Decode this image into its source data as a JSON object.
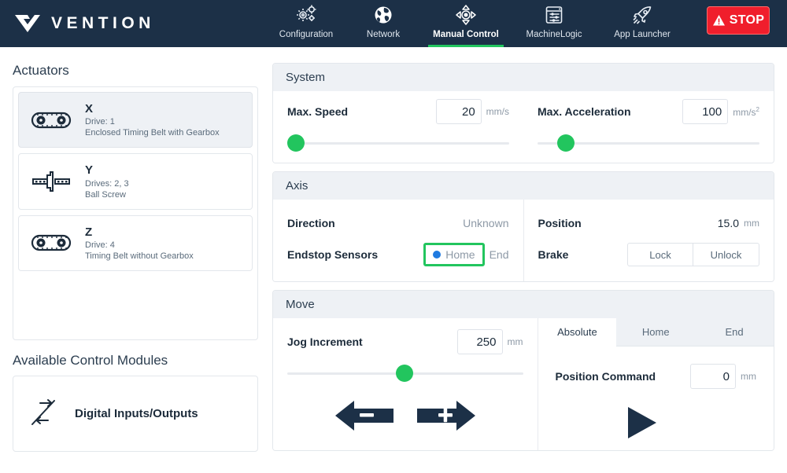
{
  "brand": {
    "name": "VENTION",
    "logo_icon": "vention-chevron-logo"
  },
  "nav": {
    "items": [
      {
        "label": "Configuration",
        "icon": "gears-icon",
        "active": false
      },
      {
        "label": "Network",
        "icon": "globe-icon",
        "active": false
      },
      {
        "label": "Manual Control",
        "icon": "four-way-arrows-icon",
        "active": true
      },
      {
        "label": "MachineLogic",
        "icon": "sliders-window-icon",
        "active": false
      },
      {
        "label": "App Launcher",
        "icon": "rocket-icon",
        "active": false
      }
    ],
    "stop_button": {
      "label": "STOP",
      "icon": "warning-triangle-icon",
      "color": "#f01e2c"
    }
  },
  "sidebar": {
    "actuators_title": "Actuators",
    "actuators": [
      {
        "axis": "X",
        "drive": "Drive: 1",
        "type": "Enclosed Timing Belt with Gearbox",
        "icon": "timing-belt-icon",
        "selected": true
      },
      {
        "axis": "Y",
        "drive": "Drives: 2, 3",
        "type": "Ball Screw",
        "icon": "ball-screw-icon",
        "selected": false
      },
      {
        "axis": "Z",
        "drive": "Drive: 4",
        "type": "Timing Belt without Gearbox",
        "icon": "timing-belt-icon",
        "selected": false
      }
    ],
    "modules_title": "Available Control Modules",
    "modules": [
      {
        "label": "Digital Inputs/Outputs",
        "icon": "input-output-arrows-icon"
      }
    ]
  },
  "system": {
    "title": "System",
    "max_speed": {
      "label": "Max. Speed",
      "value": "20",
      "unit": "mm/s",
      "slider_percent": 4
    },
    "max_acceleration": {
      "label": "Max. Acceleration",
      "value": "100",
      "unit_prefix": "mm/s",
      "unit_exp": "2",
      "slider_percent": 12
    }
  },
  "axis": {
    "title": "Axis",
    "direction_label": "Direction",
    "direction_value": "Unknown",
    "endstop_label": "Endstop Sensors",
    "endstop_home": "Home",
    "endstop_end": "End",
    "endstop_highlight_color": "#22c55e",
    "endstop_dot_color": "#1f7ae0",
    "position_label": "Position",
    "position_value": "15.0",
    "position_unit": "mm",
    "brake_label": "Brake",
    "brake_lock": "Lock",
    "brake_unlock": "Unlock"
  },
  "move": {
    "title": "Move",
    "jog_label": "Jog Increment",
    "jog_value": "250",
    "jog_unit": "mm",
    "jog_slider_percent": 47,
    "jog_minus_icon": "arrow-left-minus-icon",
    "jog_plus_icon": "arrow-right-plus-icon",
    "tabs": [
      {
        "label": "Absolute",
        "active": true
      },
      {
        "label": "Home",
        "active": false
      },
      {
        "label": "End",
        "active": false
      }
    ],
    "position_command_label": "Position Command",
    "position_command_value": "0",
    "position_command_unit": "mm",
    "play_icon": "play-triangle-icon",
    "stop_icon": "stop-square-icon"
  },
  "colors": {
    "navbar": "#1c3047",
    "accent_green": "#22c55e",
    "stop_red": "#f01e2c",
    "panel_header": "#eef1f5"
  }
}
